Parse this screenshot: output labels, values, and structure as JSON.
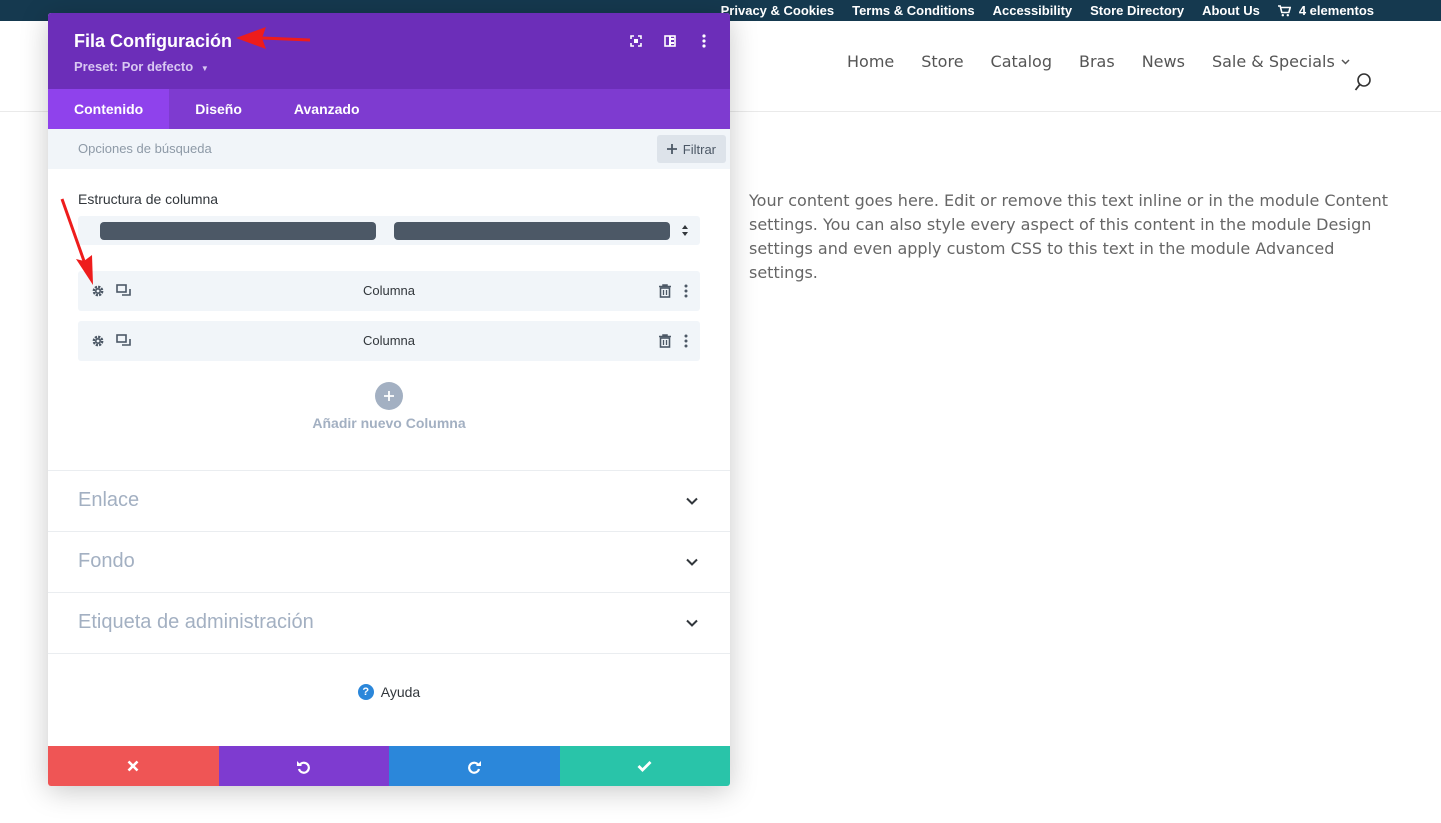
{
  "topbar": {
    "links": [
      "Privacy & Cookies",
      "Terms & Conditions",
      "Accessibility",
      "Store Directory",
      "About Us"
    ],
    "cart_label": "4 elementos"
  },
  "nav": {
    "items": [
      "Home",
      "Store",
      "Catalog",
      "Bras",
      "News",
      "Sale & Specials"
    ]
  },
  "content": {
    "text": "Your content goes here. Edit or remove this text inline or in the module Content settings. You can also style every aspect of this content in the module Design settings and even apply custom CSS to this text in the module Advanced settings."
  },
  "modal": {
    "title": "Fila Configuración",
    "preset": "Preset: Por defecto",
    "tabs": [
      "Contenido",
      "Diseño",
      "Avanzado"
    ],
    "active_tab": "Contenido",
    "search_placeholder": "Opciones de búsqueda",
    "filter_label": "Filtrar",
    "structure_label": "Estructura de columna",
    "columns": [
      "Columna",
      "Columna"
    ],
    "add_column_label": "Añadir nuevo Columna",
    "toggles": [
      "Enlace",
      "Fondo",
      "Etiqueta de administración"
    ],
    "help_label": "Ayuda"
  },
  "colors": {
    "header": "#6c2eb9",
    "tabs": "#7e3bd0",
    "active_tab": "#8f42ec",
    "cancel": "#ef5555",
    "undo": "#7e3bd0",
    "redo": "#2b87da",
    "save": "#29c4a9",
    "annotation": "#ee1c1c"
  }
}
